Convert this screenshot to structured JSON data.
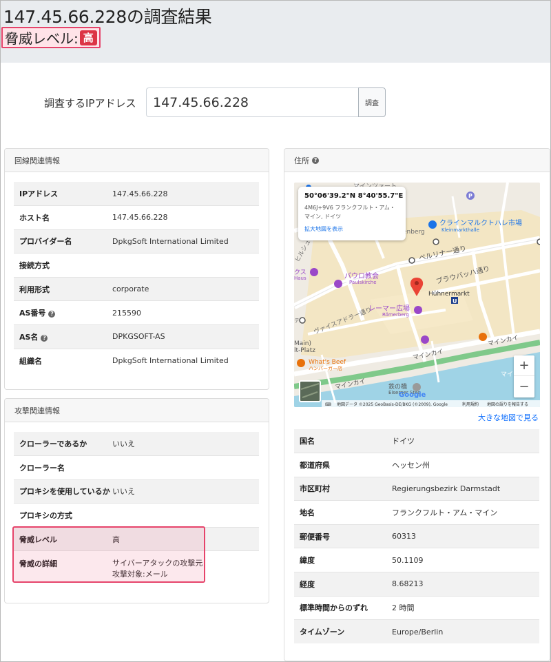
{
  "header": {
    "title": "147.45.66.228の調査結果",
    "threat_label": "脅威レベル:",
    "threat_badge": "高"
  },
  "search": {
    "label": "調査するIPアドレス",
    "value": "147.45.66.228",
    "button": "調査"
  },
  "line_info": {
    "title": "回線関連情報",
    "rows": [
      {
        "key": "IPアドレス",
        "value": "147.45.66.228"
      },
      {
        "key": "ホスト名",
        "value": "147.45.66.228"
      },
      {
        "key": "プロバイダー名",
        "value": "DpkgSoft International Limited"
      },
      {
        "key": "接続方式",
        "value": ""
      },
      {
        "key": "利用形式",
        "value": "corporate"
      },
      {
        "key": "AS番号",
        "value": "215590"
      },
      {
        "key": "AS名",
        "value": "DPKGSOFT-AS"
      },
      {
        "key": "組織名",
        "value": "DpkgSoft International Limited"
      }
    ]
  },
  "attack_info": {
    "title": "攻撃関連情報",
    "rows": [
      {
        "key": "クローラーであるか",
        "value": "いいえ"
      },
      {
        "key": "クローラー名",
        "value": ""
      },
      {
        "key": "プロキシを使用しているか",
        "value": "いいえ"
      },
      {
        "key": "プロキシの方式",
        "value": ""
      },
      {
        "key": "脅威レベル",
        "value": "高"
      },
      {
        "key": "脅威の詳細",
        "value": "サイバーアタックの攻撃元",
        "value2": "攻撃対象:メール"
      }
    ]
  },
  "address_info": {
    "title": "住所",
    "rows": [
      {
        "key": "国名",
        "value": "ドイツ"
      },
      {
        "key": "都道府県",
        "value": "ヘッセン州"
      },
      {
        "key": "市区町村",
        "value": "Regierungsbezirk Darmstadt"
      },
      {
        "key": "地名",
        "value": "フランクフルト・アム・マイン"
      },
      {
        "key": "郵便番号",
        "value": "60313"
      },
      {
        "key": "緯度",
        "value": "50.1109"
      },
      {
        "key": "経度",
        "value": "8.68213"
      },
      {
        "key": "標準時間からのずれ",
        "value": "2 時間"
      },
      {
        "key": "タイムゾーン",
        "value": "Europe/Berlin"
      }
    ]
  },
  "map": {
    "popup_coords": "50°06'39.2\"N 8°40'55.7\"E",
    "popup_address": "4M6J+9V6 フランクフルト・アム・マイン, ドイツ",
    "popup_link": "拡大地図を表示",
    "bigger_map_link": "大きな地図で見る",
    "zoom_in": "+",
    "zoom_out": "−",
    "labels": {
      "klein": "クラインマルクトハレ市場",
      "klein_sub": "Kleinmarkthalle",
      "berliner": "ベルリナー通り",
      "braubach": "ブラウバッハ通り",
      "paul": "パウロ教会",
      "paul_sub": "Paulskirche",
      "huehner": "Hühnermarkt",
      "u": "U",
      "p": "P",
      "roemer": "レーマー広場",
      "roemer_sub": "Römerberg",
      "whatsbeef": "What's Beef",
      "whatsbeef_sub": "ハンバーガー店",
      "mainkai1": "マインカイ",
      "mainkai2": "マインカイ",
      "mainkai3": "マインカイ",
      "eiserner": "鉄の橋",
      "eiserner_sub": "Eiserner Steg",
      "main_platz": "Main)",
      "main_platz2": "lt-Platz",
      "hirsch": "ヒルシュグラーベン通り",
      "weissadler": "ヴァイスアドラー通り",
      "berg": "enberg",
      "kuss": "クス",
      "haus": "Haus",
      "mainvogt": "マインツァート",
      "google": "Google",
      "attribution": "地図データ ©2025 GeoBasis-DE/BKG (©2009), Google",
      "terms": "利用規約",
      "report": "地図の誤りを報告する",
      "mai": "マイ",
      "tte": "テ"
    }
  }
}
